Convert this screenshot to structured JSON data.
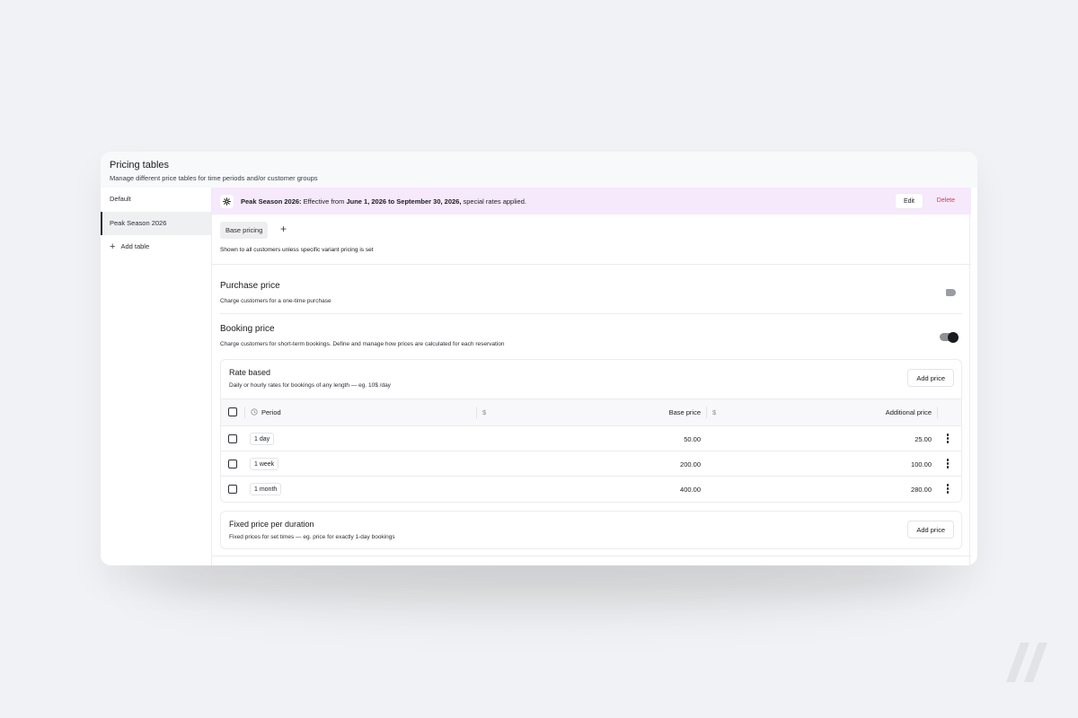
{
  "header": {
    "title": "Pricing tables",
    "subtitle": "Manage different price tables for time periods and/or customer groups"
  },
  "sidebar": {
    "items": [
      {
        "label": "Default",
        "active": false
      },
      {
        "label": "Peak Season 2026",
        "active": true
      }
    ],
    "add_label": "Add table"
  },
  "banner": {
    "name": "Peak Season 2026:",
    "text_1": " Effective from ",
    "date_range": "June 1, 2026 to September 30, 2026,",
    "text_2": " special rates applied.",
    "edit_label": "Edit",
    "delete_label": "Delete",
    "icon": "gear-icon",
    "background_color": "#f6e9fb",
    "delete_color": "#d63a5a"
  },
  "tabs": {
    "active_label": "Base pricing",
    "add_icon": "plus-icon",
    "hint": "Shown to all customers unless specific variant pricing is set"
  },
  "purchase": {
    "title": "Purchase price",
    "description": "Charge customers for a one-time purchase",
    "enabled": false
  },
  "booking": {
    "title": "Booking price",
    "description": "Charge customers for short-term bookings. Define and manage how prices are calculated for each reservation",
    "enabled": true
  },
  "rate_based": {
    "title": "Rate based",
    "description": "Daily or hourly rates for bookings of any length — eg. 10$ /day",
    "add_label": "Add price",
    "columns": {
      "period": "Period",
      "currency_1": "$",
      "base_price": "Base price",
      "currency_2": "$",
      "additional_price": "Additional price"
    },
    "rows": [
      {
        "period": "1 day",
        "base": "50.00",
        "additional": "25.00"
      },
      {
        "period": "1 week",
        "base": "200.00",
        "additional": "100.00"
      },
      {
        "period": "1 month",
        "base": "400.00",
        "additional": "280.00"
      }
    ]
  },
  "fixed_price": {
    "title": "Fixed price per duration",
    "description": "Fixed prices for set times — eg. price for exactly 1-day bookings",
    "add_label": "Add price"
  }
}
